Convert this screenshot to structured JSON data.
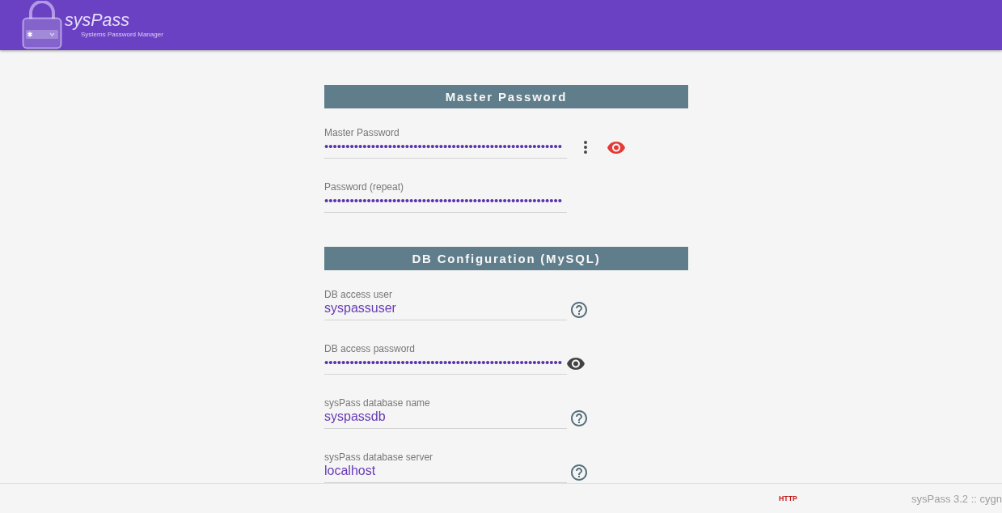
{
  "header": {
    "logo_title": "sysPass",
    "logo_subtitle": "Systems Password Manager"
  },
  "sections": [
    {
      "title": "Master Password",
      "fields": [
        {
          "label": "Master Password",
          "kind": "password",
          "value": "••••••••••••••••••••••••••••••••••••••••••••••••••••••••",
          "actions": [
            {
              "kind": "menu"
            },
            {
              "kind": "reveal",
              "color": "#e53935"
            }
          ]
        },
        {
          "label": "Password (repeat)",
          "kind": "password",
          "value": "••••••••••••••••••••••••••••••••••••••••••••••••••••••••"
        }
      ]
    },
    {
      "title": "DB Configuration (MySQL)",
      "fields": [
        {
          "label": "DB access user",
          "kind": "text",
          "value": "syspassuser",
          "actions": [
            {
              "kind": "help"
            }
          ]
        },
        {
          "label": "DB access password",
          "kind": "password",
          "value": "••••••••••••••••••••••••••••••••••••••••••••••••••••••••",
          "actions": [
            {
              "kind": "reveal",
              "color": "#424242"
            }
          ]
        },
        {
          "label": "sysPass database name",
          "kind": "text",
          "value": "syspassdb",
          "actions": [
            {
              "kind": "help"
            }
          ]
        },
        {
          "label": "sysPass database server",
          "kind": "text",
          "value": "localhost",
          "actions": [
            {
              "kind": "help"
            }
          ]
        }
      ]
    }
  ],
  "footer": {
    "protocol": "HTTP",
    "version": "sysPass 3.2 :: cygn"
  }
}
